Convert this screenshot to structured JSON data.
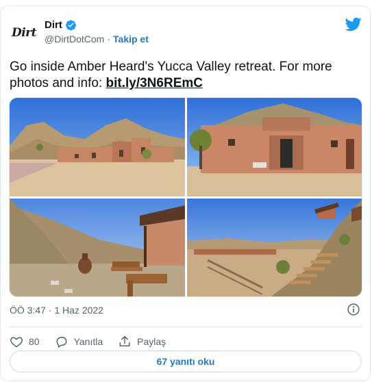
{
  "author": {
    "avatar_text": "Dirt",
    "display_name": "Dirt",
    "handle": "@DirtDotCom",
    "separator": "·",
    "follow_label": "Takip et"
  },
  "tweet": {
    "text": "Go inside Amber Heard's Yucca Valley retreat. For more photos and info: ",
    "link": "bit.ly/3N6REmC"
  },
  "timestamp": "ÖÖ 3:47 · 1 Haz 2022",
  "actions": {
    "likes": "80",
    "reply_label": "Yanıtla",
    "share_label": "Paylaş"
  },
  "replies_button": "67 yanıtı oku",
  "icons": {
    "verified": "verified-badge-icon",
    "twitter": "twitter-bird-icon",
    "info": "info-icon",
    "heart": "heart-icon",
    "reply": "reply-icon",
    "share": "share-icon"
  },
  "colors": {
    "accent": "#1d9bf0",
    "link_blue": "#1d7bbf",
    "muted": "#536471",
    "border": "#e1e8ed"
  }
}
